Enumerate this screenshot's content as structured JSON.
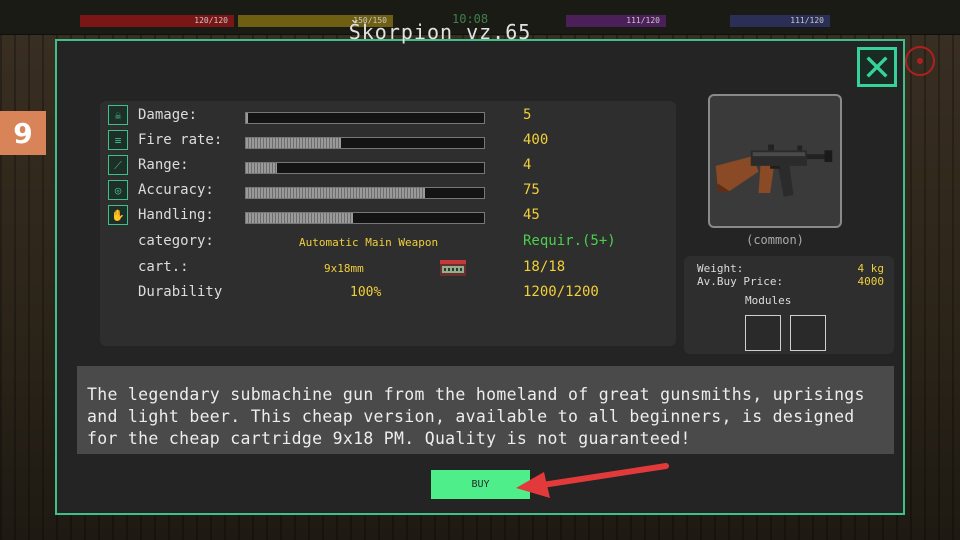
{
  "hud": {
    "health_text": "120/120",
    "stamina_text": "150/150",
    "time_text": "10:08",
    "energy_text": "111/120",
    "water_text": "111/120"
  },
  "level_badge": "9",
  "modal": {
    "title": "Škorpion vz.65",
    "close_icon": "close-x-icon",
    "accent_color": "#3fbf8a"
  },
  "stats": [
    {
      "label": "Damage:",
      "value": "5",
      "fill": 0.01,
      "icon": "skull-icon"
    },
    {
      "label": "Fire rate:",
      "value": "400",
      "fill": 0.4,
      "icon": "fire-rate-icon"
    },
    {
      "label": "Range:",
      "value": "4",
      "fill": 0.13,
      "icon": "range-icon"
    },
    {
      "label": "Accuracy:",
      "value": "75",
      "fill": 0.75,
      "icon": "accuracy-icon"
    },
    {
      "label": "Handling:",
      "value": "45",
      "fill": 0.45,
      "icon": "handling-icon"
    }
  ],
  "info": {
    "category_label": "category:",
    "category_value": "Automatic Main Weapon",
    "requirement": "Requir.(5+)",
    "cart_label": "cart.:",
    "cart_value": "9x18mm",
    "cart_icon": "ammo-box-icon",
    "cart_count": "18/18",
    "durability_label": "Durability",
    "durability_pct": "100%",
    "durability_value": "1200/1200"
  },
  "weapon": {
    "image_icon": "smg-icon",
    "rarity": "(common)"
  },
  "side": {
    "weight_label": "Weight:",
    "weight_value": "4 kg",
    "price_label": "Av.Buy Price:",
    "price_value": "4000",
    "modules_label": "Modules"
  },
  "description": "The legendary submachine gun from the homeland of great gunsmiths, uprisings and light beer. This cheap version, available to all beginners, is designed for the cheap cartridge 9x18 PM. Quality is not guaranteed!",
  "buy_label": "BUY",
  "colors": {
    "value_yellow": "#f0cf3a",
    "requirement_green": "#4bd04b",
    "buy_button": "#4eee8a",
    "arrow_red": "#e23a3a"
  }
}
